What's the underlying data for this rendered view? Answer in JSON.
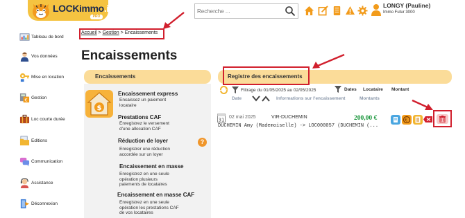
{
  "header": {
    "logo_main": "LOCKimmo",
    "logo_io": ".io",
    "logo_tag": "PRO",
    "search_placeholder": "Recherche ...",
    "user_name": "LONGY (Pauline)",
    "user_company": "Immo Futur 3000",
    "icons": [
      "home-icon",
      "edit-icon",
      "documents-icon",
      "alert-icon",
      "gear-icon",
      "user-icon"
    ]
  },
  "sidebar": {
    "items": [
      {
        "label": "Tableau de bord",
        "icon": "dashboard-icon"
      },
      {
        "label": "Vos données",
        "icon": "person-icon"
      },
      {
        "label": "Mise en location",
        "icon": "key-icon"
      },
      {
        "label": "Gestion",
        "icon": "calculator-icon"
      },
      {
        "label": "Loc courte durée",
        "icon": "suitcase-icon"
      },
      {
        "label": "Editions",
        "icon": "folder-icon"
      },
      {
        "label": "Communication",
        "icon": "chat-icon"
      },
      {
        "label": "Assistance",
        "icon": "support-icon"
      },
      {
        "label": "Déconnexion",
        "icon": "logout-icon"
      }
    ]
  },
  "breadcrumb": {
    "home": "Accueil",
    "sep1": ">",
    "section": "Gestion",
    "sep2": ">",
    "current": "Encaissements"
  },
  "page_title": "Encaissements",
  "left_panel": {
    "title": "Encaissements",
    "options": [
      {
        "title": "Encaissement express",
        "desc": "Encaissez un paiement\nlocataire"
      },
      {
        "title": "Prestations CAF",
        "desc": "Enregistrez le versement\nd'une allocation CAF"
      },
      {
        "title": "Réduction de loyer",
        "desc": "Enregistrer une réduction\naccordée sur un loyer"
      },
      {
        "title": "Encaissement en masse",
        "desc": "Enregistrez en une seule\nopération plusieurs\npaiements de locataires"
      },
      {
        "title": "Encaissement en masse CAF",
        "desc": "Enregistrez en une seule\nopération les prestations CAF\nde vos locataires"
      }
    ],
    "help_glyph": "?"
  },
  "right_panel": {
    "title": "Registre des encaissements",
    "filter_text": "Filtrage du 01/05/2025 au 02/05/2025",
    "columns": [
      "Dates",
      "Locataire",
      "Montant"
    ],
    "subheader": {
      "date": "Date",
      "info": "Informations sur l'encaissement",
      "amount": "Montants"
    },
    "rows": [
      {
        "date": "02 mai 2025",
        "mode": "VIR-DUCHEMIN",
        "amount": "200,00 €",
        "description": "DUCHEMIN Amy (Mademoiselle) -> LOC000057 (DUCHEMIN (..."
      }
    ],
    "row_actions": [
      "receipt-icon",
      "euro-icon",
      "document-icon",
      "unlink-icon",
      "delete-icon"
    ]
  },
  "colors": {
    "panel_header": "#fbdc99",
    "highlight_red": "#d11f2d",
    "amount_green": "#18953a",
    "accent_orange": "#f0962b"
  }
}
